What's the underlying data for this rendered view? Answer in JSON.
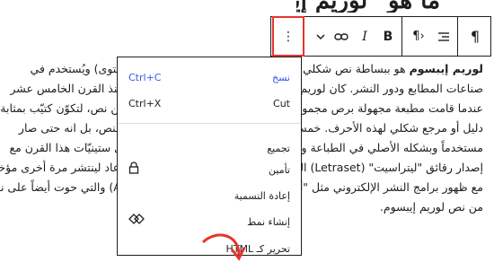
{
  "heading_fragment": "ما هو \"لوريم إيبسوم\" ؟",
  "toolbar": {
    "paragraph_icon": "¶",
    "align_icon": "align-right-icon",
    "direction_label": "¶›",
    "bold": "B",
    "italic": "I",
    "link_icon": "link-icon",
    "chevron_icon": "chevron-down-icon",
    "more_icon": "⋮"
  },
  "paragraph": {
    "bold_lead": "لوريم إيبسوم",
    "line1_rest": " هو ببساطة نص شكلي (بمعنى أن الغاية هي الشكل وليس المحتوى) ويُستخدم في",
    "line2": "صناعات المطابع ودور النشر. كان لوريم إيبسوم ولايزال المعيار للنص الشكلي منذ القرن الخامس عشر",
    "line3": "عندما قامت مطبعة مجهولة برص مجموعة من الأحرف بشكل عشوائي أخذتها من نص، لتكوّن كتيّب بمثابة",
    "line4": "دليل أو مرجع شكلي لهذه الأحرف. خمسة قرون من الزمن لم تقضي على هذا النص، بل انه حتى صار",
    "line5": "مستخدماً وبشكله الأصلي في الطباعة والتنضيد الإلكتروني. انتشر بشكل كبير في ستينيّات هذا القرن مع",
    "line6": "إصدار رقائق \"ليتراسيت\" (Letraset) البلاستيكية تحوي مقاطع من هذا النص، وعاد لينتشر مرة أخرى مؤخراً",
    "line7": "مع ظهور برامج النشر الإلكتروني مثل \"ألدوس بايج مايكر\" (Aldus PageMaker) والتي حوت أيضاً على نسخ",
    "line8": "من نص لوريم إيبسوم."
  },
  "menu": {
    "copy": {
      "label": "نسخ",
      "shortcut": "Ctrl+C"
    },
    "cut": {
      "label": "Cut",
      "shortcut": "Ctrl+X"
    },
    "group": "تجميع",
    "lock": {
      "label": "تأمين",
      "icon": "lock-icon"
    },
    "rename": "إعادة التسمية",
    "create_pattern": {
      "label": "إنشاء نمط",
      "icon": "pattern-diamond-icon"
    },
    "edit_html": "تحرير كـ HTML"
  },
  "colors": {
    "accent": "#3858e9",
    "highlight": "#e5352b"
  }
}
